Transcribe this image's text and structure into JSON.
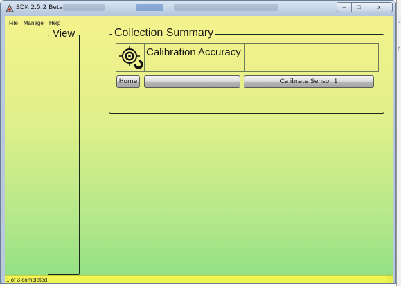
{
  "window": {
    "title": "SDK 2.5.2 Beta",
    "controls": {
      "minimize": "–",
      "maximize": "□",
      "close": "x"
    }
  },
  "menu": [
    {
      "label": "File"
    },
    {
      "label": "Manage"
    },
    {
      "label": "Help"
    }
  ],
  "view_panel": {
    "legend": "View"
  },
  "collection_summary": {
    "legend": "Collection Summary",
    "card": {
      "icon": "calibration-target-icon",
      "label": "Calibration Accuracy",
      "value": ""
    },
    "buttons": {
      "home": "Home",
      "middle": "",
      "calibrate": "Calibrate Sensor 1"
    }
  },
  "statusbar": {
    "text": "1 of 3 completed"
  },
  "background_window": {
    "glyphs": [
      "?",
      "h"
    ]
  },
  "colors": {
    "gradient_top": "#f4f28c",
    "gradient_bottom": "#8fde84",
    "statusbar": "#f4f85a"
  }
}
